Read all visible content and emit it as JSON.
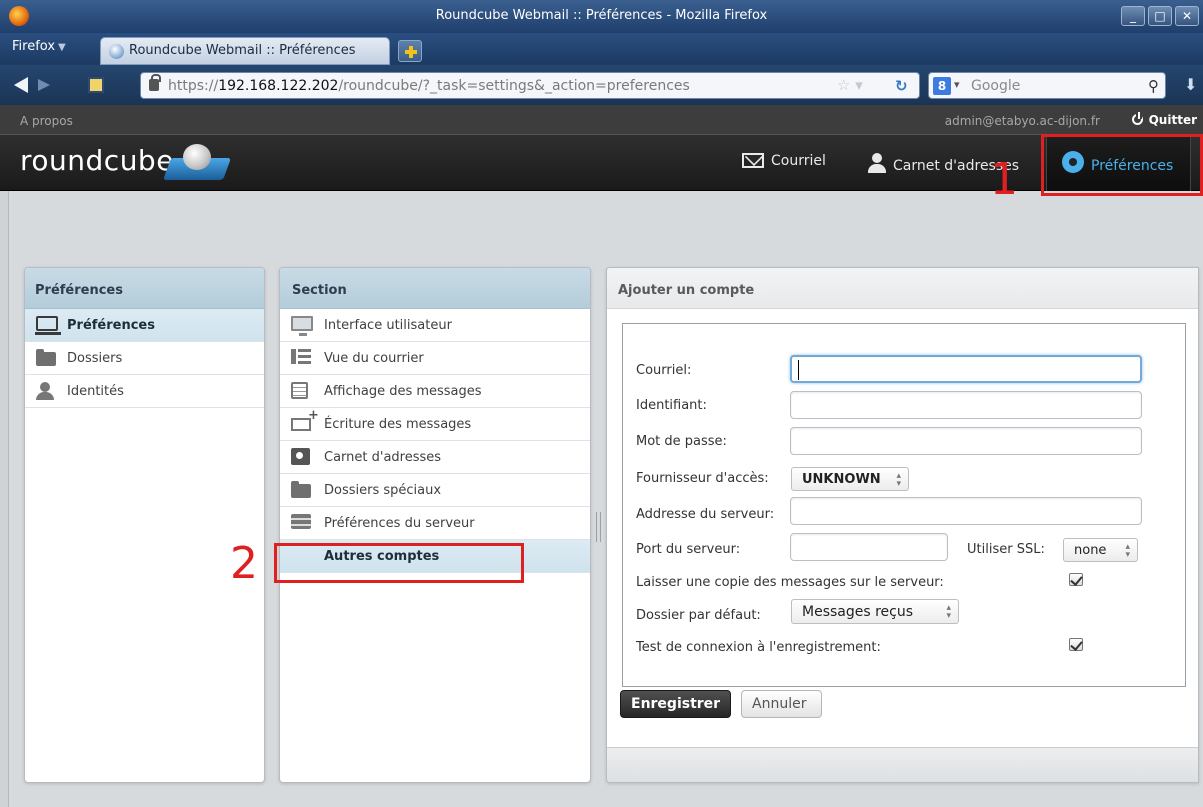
{
  "browser": {
    "window_title": "Roundcube Webmail :: Préférences - Mozilla Firefox",
    "menu_label": "Firefox",
    "tab_label": "Roundcube Webmail :: Préférences",
    "url_prefix": "https://",
    "url_host": "192.168.122.202",
    "url_path": "/roundcube/?_task=settings&_action=preferences",
    "search_engine": "Google",
    "window_buttons": [
      "_",
      "□",
      "✕"
    ]
  },
  "topline": {
    "about": "A propos",
    "user": "admin@etabyo.ac-dijon.fr",
    "logout": "Quitter"
  },
  "header": {
    "logo": "roundcube",
    "nav": {
      "mail": "Courriel",
      "contacts": "Carnet d'adresses",
      "settings": "Préférences"
    }
  },
  "annotations": {
    "one": "1",
    "two": "2"
  },
  "prefs_panel": {
    "title": "Préférences",
    "items": [
      {
        "label": "Préférences",
        "icon": "laptop-icon",
        "selected": true
      },
      {
        "label": "Dossiers",
        "icon": "folder-icon"
      },
      {
        "label": "Identités",
        "icon": "person-icon"
      }
    ]
  },
  "section_panel": {
    "title": "Section",
    "items": [
      {
        "label": "Interface utilisateur",
        "icon": "monitor-icon"
      },
      {
        "label": "Vue du courrier",
        "icon": "list-view-icon"
      },
      {
        "label": "Affichage des messages",
        "icon": "document-icon"
      },
      {
        "label": "Écriture des messages",
        "icon": "compose-icon"
      },
      {
        "label": "Carnet d'adresses",
        "icon": "address-card-icon"
      },
      {
        "label": "Dossiers spéciaux",
        "icon": "folder-icon"
      },
      {
        "label": "Préférences du serveur",
        "icon": "server-icon"
      },
      {
        "label": "Autres comptes",
        "selected": true
      }
    ]
  },
  "form": {
    "title": "Ajouter un compte",
    "email_label": "Courriel:",
    "email_value": "",
    "login_label": "Identifiant:",
    "login_value": "",
    "password_label": "Mot de passe:",
    "password_value": "",
    "provider_label": "Fournisseur d'accès:",
    "provider_value": "UNKNOWN",
    "server_label": "Addresse du serveur:",
    "server_value": "",
    "port_label": "Port du serveur:",
    "port_value": "",
    "ssl_label": "Utiliser SSL:",
    "ssl_value": "none",
    "keep_copy_label": "Laisser une copie des messages sur le serveur:",
    "keep_copy_checked": true,
    "default_folder_label": "Dossier par défaut:",
    "default_folder_value": "Messages reçus",
    "test_connection_label": "Test de connexion à l'enregistrement:",
    "test_connection_checked": true,
    "save_button": "Enregistrer",
    "cancel_button": "Annuler"
  },
  "colors": {
    "accent": "#4ab0ec",
    "annotation": "#e02020",
    "header_bg": "#1a1a1a",
    "panel_header": "#c8dbe6"
  }
}
